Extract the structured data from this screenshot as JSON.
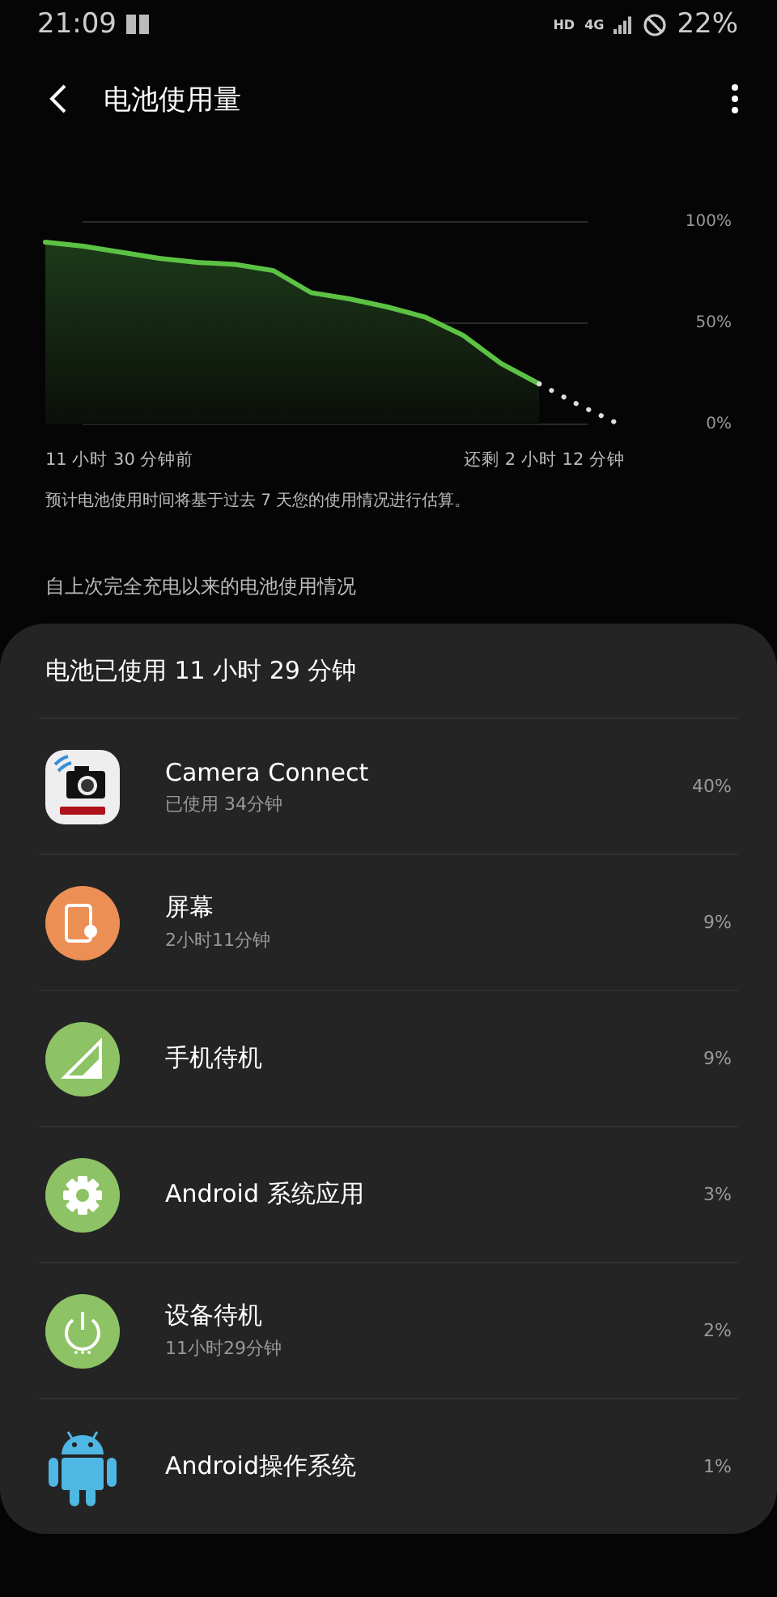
{
  "status_bar": {
    "time": "21:09",
    "network_label": "HD",
    "network_type": "4G",
    "battery": "22%"
  },
  "header": {
    "title": "电池使用量"
  },
  "chart": {
    "y_labels": [
      "100%",
      "50%",
      "0%"
    ],
    "start_label": "11 小时 30 分钟前",
    "end_label": "还剩 2 小时 12 分钟"
  },
  "estimate_note": "预计电池使用时间将基于过去 7 天您的使用情况进行估算。",
  "section_title": "自上次完全充电以来的电池使用情况",
  "usage_sheet": {
    "title": "电池已使用 11 小时 29 分钟",
    "items": [
      {
        "kind": "camera",
        "name": "Camera Connect",
        "detail": "已使用 34分钟",
        "percent": "40%"
      },
      {
        "kind": "screen",
        "name": "屏幕",
        "detail": "2小时11分钟",
        "percent": "9%"
      },
      {
        "kind": "signal",
        "name": "手机待机",
        "percent": "9%"
      },
      {
        "kind": "system",
        "name": "Android 系统应用",
        "percent": "3%"
      },
      {
        "kind": "standby",
        "name": "设备待机",
        "detail": "11小时29分钟",
        "percent": "2%"
      },
      {
        "kind": "android",
        "name": "Android操作系统",
        "percent": "1%"
      }
    ]
  }
}
